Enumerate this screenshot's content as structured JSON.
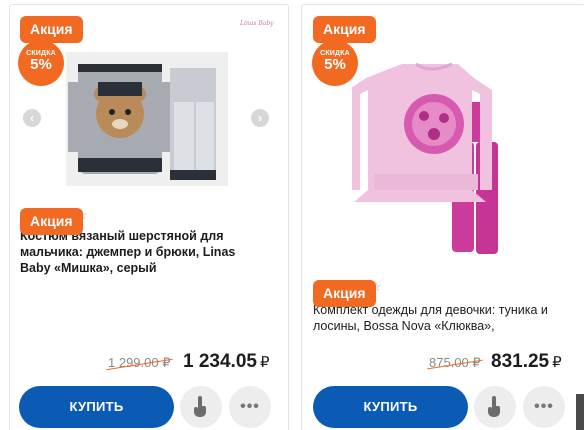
{
  "colors": {
    "accent": "#f26a21",
    "buy": "#0b5bb5"
  },
  "products": [
    {
      "promo": "Акция",
      "discount_label": "СКИДКА",
      "discount_value": "5%",
      "brand": "Linas Baby",
      "title_line_1": "Костюм вязаный шерстяной для",
      "title_line_2": "мальчика: джемпер и брюки, Linas",
      "title_line_3": "Baby «Мишка», серый",
      "old_price": "1 299.00 ₽",
      "new_price": "1 234.05",
      "currency": "₽",
      "buy_label": "КУПИТЬ",
      "icons": {
        "tap": "hand-pointer-icon",
        "more": "more-dots-icon",
        "fav": "star-outline-icon"
      }
    },
    {
      "promo": "Акция",
      "discount_label": "СКИДКА",
      "discount_value": "5%",
      "title_line_1": "Комплект одежды для девочки: туника и",
      "title_line_2": "лосины, Bossa Nova «Клюква»,",
      "old_price": "875.00 ₽",
      "new_price": "831.25",
      "currency": "₽",
      "buy_label": "КУПИТЬ",
      "icons": {
        "tap": "hand-pointer-icon",
        "more": "more-dots-icon",
        "fav": "star-outline-icon"
      }
    }
  ],
  "more_glyph": "•••",
  "star_glyph": "☆",
  "arrow_prev": "‹",
  "arrow_next": "›"
}
